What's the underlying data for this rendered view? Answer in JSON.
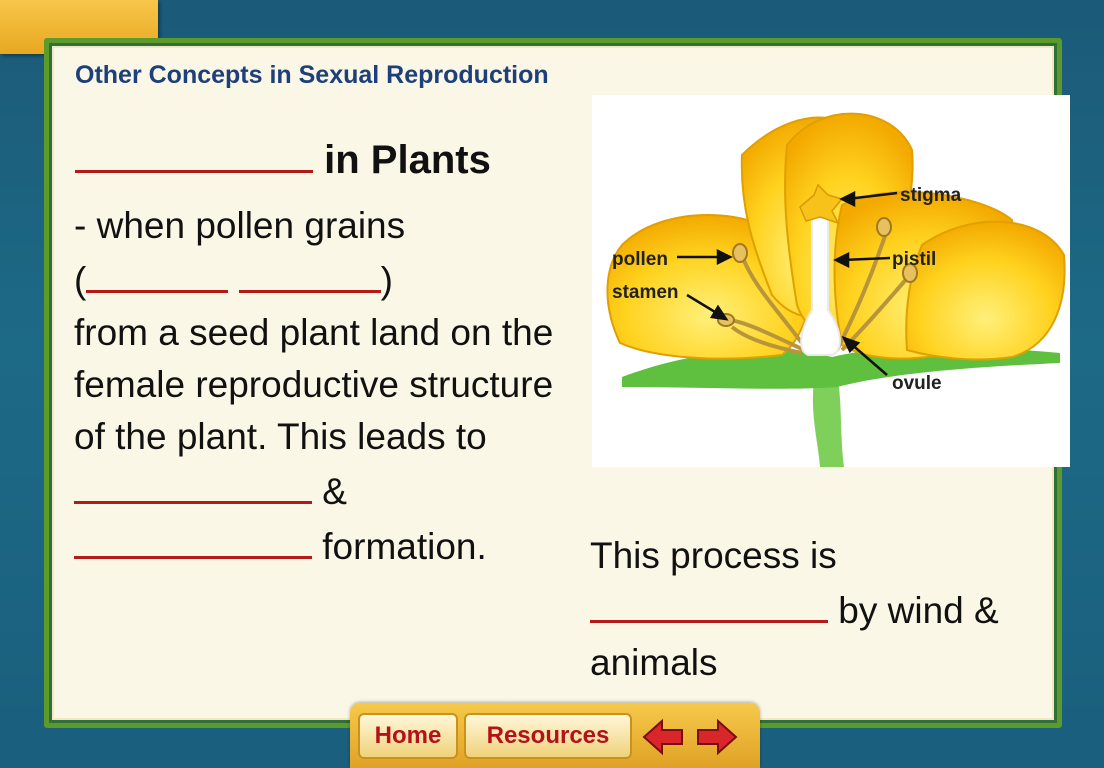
{
  "slide": {
    "header": "Other Concepts in Sexual Reproduction",
    "title_suffix": " in Plants",
    "body_line1": "- when pollen grains",
    "body_paren_open": "(",
    "body_paren_close": ")",
    "body_line3": " from a seed plant land on the female reproductive structure of the plant. This leads to ",
    "body_amp": " &",
    "body_end": " formation.",
    "note_start": "This process is",
    "note_mid": " by wind &",
    "note_end": "animals"
  },
  "diagram": {
    "labels": {
      "stigma": "stigma",
      "pollen": "pollen",
      "pistil": "pistil",
      "stamen": "stamen",
      "ovule": "ovule"
    },
    "colors": {
      "petal_outer": "#f5b800",
      "petal_inner": "#ffe23a",
      "stem": "#5fbf3f",
      "stamen": "#c09a3a"
    }
  },
  "nav": {
    "home": "Home",
    "resources": "Resources",
    "back_icon": "left-arrow-icon",
    "forward_icon": "right-arrow-icon"
  },
  "colors": {
    "header_text": "#1d3f7a",
    "blank_line": "#b31a1a",
    "nav_text": "#b3121b"
  }
}
